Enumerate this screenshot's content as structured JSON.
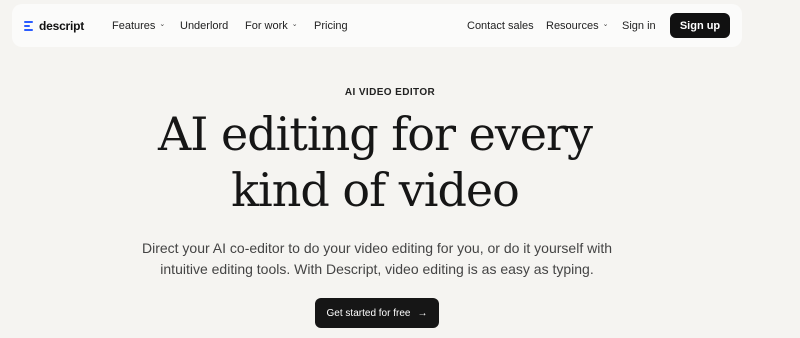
{
  "nav": {
    "logo_text": "descript",
    "features": "Features",
    "underlord": "Underlord",
    "for_work": "For work",
    "pricing": "Pricing",
    "contact_sales": "Contact sales",
    "resources": "Resources",
    "sign_in": "Sign in",
    "sign_up": "Sign up"
  },
  "hero": {
    "eyebrow": "AI VIDEO EDITOR",
    "headline_line1": "AI editing for every",
    "headline_line2": "kind of video",
    "subtitle_line1": "Direct your AI co-editor to do your video editing for you, or do it yourself with",
    "subtitle_line2": "intuitive editing tools. With Descript, video editing is as easy as typing.",
    "cta_label": "Get started for free"
  },
  "colors": {
    "background": "#f5f4f1",
    "nav_background": "#fbfbfa",
    "button": "#111111",
    "logo_accent": "#2b5cff"
  },
  "icons": {
    "logo": "descript-logo-icon",
    "dropdown": "chevron-down-icon",
    "cta_arrow": "arrow-right-icon"
  }
}
